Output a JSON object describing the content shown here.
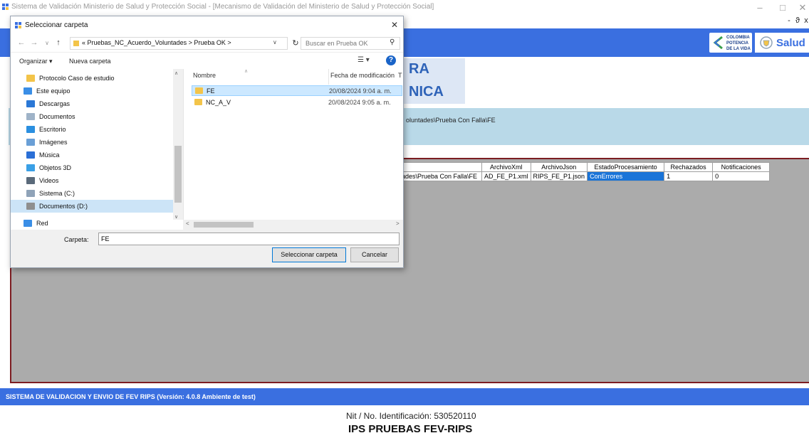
{
  "main": {
    "window_title": "Sistema de Validación Ministerio de Salud y Protección Social - [Mecanismo de Validación del Ministerio de Salud y Protección Social]",
    "mdi_controls": [
      "-",
      "ϑ",
      "x"
    ],
    "logo_text": "COLOMBIA POTENCIA DE LA VIDA",
    "salud_text": "Salud",
    "heading_line1": "RA",
    "heading_line2": "NICA",
    "path_text": "oluntades\\Prueba Con Falla\\FE",
    "grid": {
      "headers": [
        "",
        "ArchivoXml",
        "ArchivoJson",
        "EstadoProcesamiento",
        "Rechazados",
        "Notificaciones"
      ],
      "rows": [
        [
          "ades\\Prueba Con Falla\\FE",
          "AD_FE_P1.xml",
          "RIPS_FE_P1.json",
          "ConErrores",
          "1",
          "0"
        ]
      ]
    },
    "footer": "SISTEMA DE VALIDACION Y ENVIO DE FEV RIPS  (Versión: 4.0.8 Ambiente de test)",
    "nit": "Nit / No. Identificación: 530520110",
    "ips": "IPS PRUEBAS FEV-RIPS"
  },
  "dialog": {
    "title": "Seleccionar carpeta",
    "breadcrumb": "«  Pruebas_NC_Acuerdo_Voluntades  >  Prueba OK  >",
    "search_placeholder": "Buscar en Prueba OK",
    "organize": "Organizar ▾",
    "new_folder": "Nueva carpeta",
    "nav_items": [
      {
        "label": "Protocolo Caso de estudio",
        "icon": "folder-icon",
        "color": "#f3c449"
      },
      {
        "label": "Este equipo",
        "icon": "computer-icon",
        "color": "#3a8ee6"
      },
      {
        "label": "Descargas",
        "icon": "downloads-icon",
        "color": "#2b78d6"
      },
      {
        "label": "Documentos",
        "icon": "documents-icon",
        "color": "#9fb3c8"
      },
      {
        "label": "Escritorio",
        "icon": "desktop-icon",
        "color": "#2b8fe0"
      },
      {
        "label": "Imágenes",
        "icon": "pictures-icon",
        "color": "#6a9fd6"
      },
      {
        "label": "Música",
        "icon": "music-icon",
        "color": "#2b6fd6"
      },
      {
        "label": "Objetos 3D",
        "icon": "objects3d-icon",
        "color": "#3aa0e6"
      },
      {
        "label": "Videos",
        "icon": "videos-icon",
        "color": "#5a6a7a"
      },
      {
        "label": "Sistema (C:)",
        "icon": "drive-icon",
        "color": "#8fa3b8"
      },
      {
        "label": "Documentos (D:)",
        "icon": "drive-icon",
        "color": "#8f8f8f"
      },
      {
        "label": "Red",
        "icon": "network-icon",
        "color": "#3a8ee6"
      }
    ],
    "col_name": "Nombre",
    "col_date": "Fecha de modificación",
    "col_more": "T",
    "files": [
      {
        "name": "FE",
        "date": "20/08/2024 9:04 a. m.",
        "selected": true
      },
      {
        "name": "NC_A_V",
        "date": "20/08/2024 9:05 a. m.",
        "selected": false
      }
    ],
    "folder_label": "Carpeta:",
    "folder_value": "FE",
    "select_button": "Seleccionar carpeta",
    "cancel_button": "Cancelar"
  }
}
